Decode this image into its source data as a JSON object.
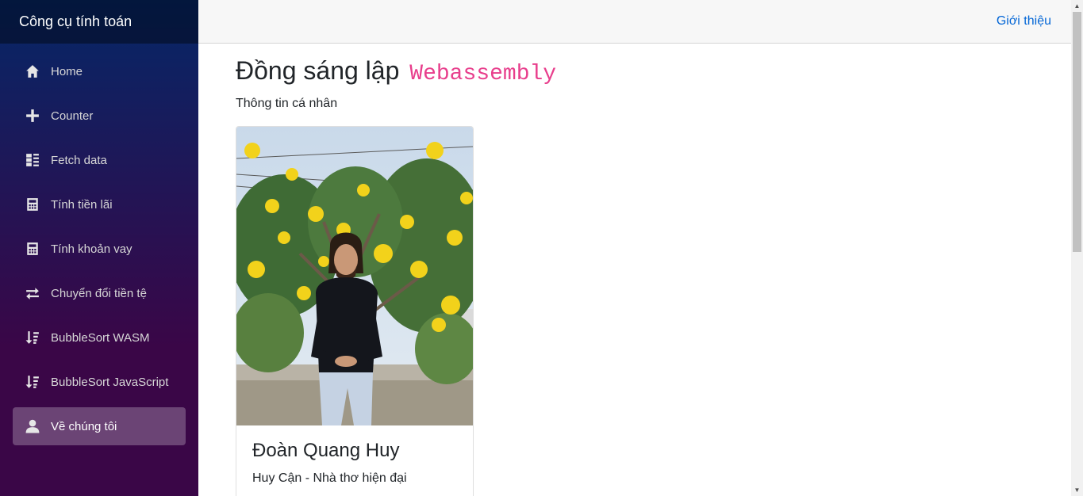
{
  "sidebar": {
    "brand": "Công cụ tính toán",
    "items": [
      {
        "label": "Home",
        "icon": "home-icon"
      },
      {
        "label": "Counter",
        "icon": "plus-icon"
      },
      {
        "label": "Fetch data",
        "icon": "list-icon"
      },
      {
        "label": "Tính tiền lãi",
        "icon": "calculator-icon"
      },
      {
        "label": "Tính khoản vay",
        "icon": "calculator-icon"
      },
      {
        "label": "Chuyển đổi tiền tệ",
        "icon": "transfer-icon"
      },
      {
        "label": "BubbleSort WASM",
        "icon": "sort-icon"
      },
      {
        "label": "BubbleSort JavaScript",
        "icon": "sort-icon"
      },
      {
        "label": "Về chúng tôi",
        "icon": "person-icon",
        "active": true
      }
    ]
  },
  "header": {
    "about_link": "Giới thiệu"
  },
  "main": {
    "title": "Đồng sáng lập",
    "title_code": "Webassembly",
    "subtitle": "Thông tin cá nhân",
    "card": {
      "name": "Đoàn Quang Huy",
      "description": "Huy Cận - Nhà thơ hiện đại"
    }
  },
  "colors": {
    "accent_link": "#0366d6",
    "code_pink": "#e83e8c",
    "sidebar_top": "#052767",
    "sidebar_bottom": "#3a0647"
  }
}
